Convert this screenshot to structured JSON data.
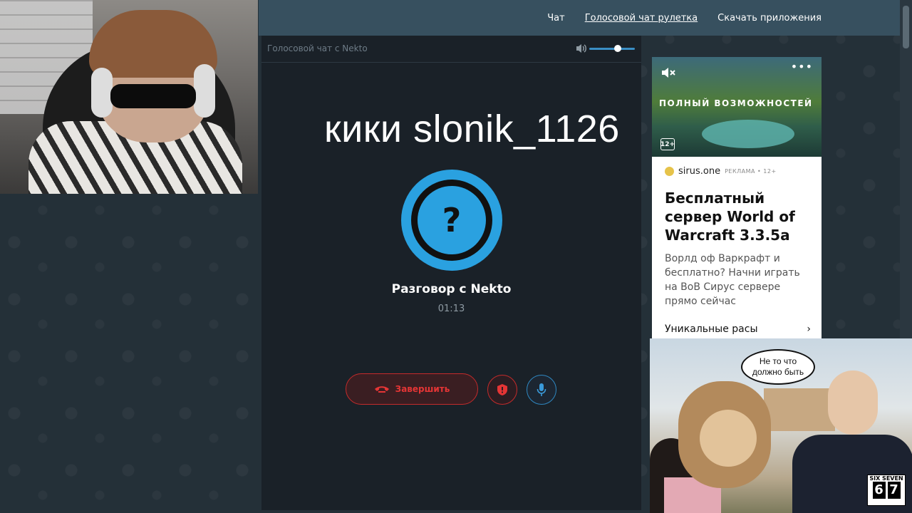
{
  "nav": {
    "links": [
      {
        "label": "Чат",
        "active": false
      },
      {
        "label": "Голосовой чат рулетка",
        "active": true
      },
      {
        "label": "Скачать приложения",
        "active": false
      }
    ]
  },
  "panel": {
    "title": "Голосовой чат с Nekto",
    "volume_level": 0.55
  },
  "overlay": {
    "text": "кики slonik_1126"
  },
  "call": {
    "avatar_symbol": "?",
    "title": "Разговор с Nekto",
    "timer": "01:13",
    "end_label": "Завершить"
  },
  "ad": {
    "image_text": "ПОЛНЫЙ ВОЗМОЖНОСТЕЙ",
    "age_rating": "12+",
    "more": "•••",
    "domain": "sirus.one",
    "label": "РЕКЛАМА • 12+",
    "headline": "Бесплатный сервер World of Warcraft 3.3.5a",
    "description": "Ворлд оф Варкрафт и бесплатно? Начни играть на ВоВ Сирус сервере прямо сейчас",
    "link": "Уникальные расы",
    "link_arrow": "›"
  },
  "meme": {
    "speech_line1": "Не то что",
    "speech_line2": "должно быть",
    "badge_top": "SIX SEVEN",
    "badge_d1": "6",
    "badge_d2": "7"
  },
  "colors": {
    "accent_blue": "#2aa1e0",
    "end_red": "#e53535",
    "nav_bg": "#37505f",
    "panel_bg": "#1a2128"
  }
}
